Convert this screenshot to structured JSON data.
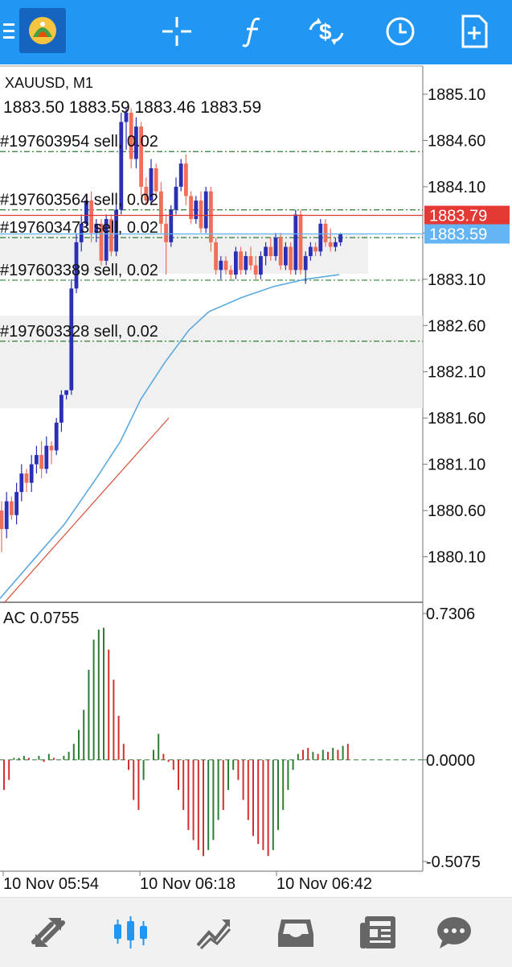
{
  "toolbar": {
    "icons": [
      "menu-icon",
      "metatrader-logo-icon",
      "crosshair-icon",
      "function-icon",
      "trade-icon",
      "clock-icon",
      "new-document-icon"
    ]
  },
  "chart_header": {
    "symbol": "XAUUSD, M1",
    "ohlc": "1883.50 1883.59 1883.46 1883.59"
  },
  "colors": {
    "accent": "#2196f3",
    "bull": "#2a2fb4",
    "bear": "#ef6f5a",
    "ask_line": "#e53935",
    "bid_line": "#64b5f6",
    "order_line": "#2e7d32",
    "ac_up": "#2e7d32",
    "ac_down": "#d32f2f"
  },
  "chart_data": {
    "type": "line",
    "price_axis": {
      "ticks": [
        "1885.10",
        "1884.60",
        "1884.10",
        "1883.60",
        "1883.10",
        "1882.60",
        "1882.10",
        "1881.60",
        "1881.10",
        "1880.60",
        "1880.10"
      ],
      "ylim": [
        1879.75,
        1885.3
      ]
    },
    "time_labels": [
      "10 Nov 05:54",
      "10 Nov 06:18",
      "10 Nov 06:42"
    ],
    "ask_price": "1883.79",
    "bid_price": "1883.59",
    "orders": [
      {
        "label": "#197603954 sell, 0.02",
        "price": 1884.48
      },
      {
        "label": "#197603564 sell, 0.02",
        "price": 1883.85
      },
      {
        "label": "#197603473 sell, 0.02",
        "price": 1883.55
      },
      {
        "label": "#197603389 sell, 0.02",
        "price": 1883.09
      },
      {
        "label": "#197603328 sell, 0.02",
        "price": 1882.43
      }
    ],
    "candles": [
      [
        1880.6,
        1880.7,
        1880.15,
        1880.4
      ],
      [
        1880.4,
        1880.8,
        1880.3,
        1880.7
      ],
      [
        1880.7,
        1880.75,
        1880.5,
        1880.55
      ],
      [
        1880.55,
        1880.9,
        1880.45,
        1880.8
      ],
      [
        1880.8,
        1881.1,
        1880.7,
        1881.0
      ],
      [
        1881.0,
        1881.05,
        1880.8,
        1880.9
      ],
      [
        1880.9,
        1881.2,
        1880.8,
        1881.1
      ],
      [
        1881.1,
        1881.3,
        1881.0,
        1881.2
      ],
      [
        1881.2,
        1881.35,
        1880.95,
        1881.05
      ],
      [
        1881.05,
        1881.4,
        1881.0,
        1881.3
      ],
      [
        1881.3,
        1881.35,
        1881.1,
        1881.25
      ],
      [
        1881.25,
        1881.6,
        1881.2,
        1881.55
      ],
      [
        1881.55,
        1881.9,
        1881.45,
        1881.85
      ],
      [
        1881.85,
        1881.9,
        1881.8,
        1881.9
      ],
      [
        1881.9,
        1883.1,
        1881.85,
        1883.0
      ],
      [
        1883.0,
        1883.6,
        1882.95,
        1883.5
      ],
      [
        1883.5,
        1883.8,
        1883.4,
        1883.7
      ],
      [
        1883.7,
        1884.0,
        1883.65,
        1883.95
      ],
      [
        1883.95,
        1884.05,
        1883.5,
        1883.6
      ],
      [
        1883.6,
        1883.75,
        1883.5,
        1883.7
      ],
      [
        1883.7,
        1883.75,
        1883.25,
        1883.3
      ],
      [
        1883.3,
        1883.8,
        1883.25,
        1883.75
      ],
      [
        1883.75,
        1883.8,
        1883.35,
        1883.4
      ],
      [
        1883.4,
        1883.9,
        1883.35,
        1883.85
      ],
      [
        1883.85,
        1884.9,
        1883.8,
        1884.8
      ],
      [
        1884.8,
        1884.95,
        1884.5,
        1884.9
      ],
      [
        1884.9,
        1884.95,
        1884.3,
        1884.4
      ],
      [
        1884.4,
        1884.85,
        1884.3,
        1884.75
      ],
      [
        1884.75,
        1884.8,
        1884.0,
        1884.1
      ],
      [
        1884.1,
        1884.2,
        1883.9,
        1883.95
      ],
      [
        1883.95,
        1884.4,
        1883.9,
        1884.3
      ],
      [
        1884.3,
        1884.35,
        1884.0,
        1884.05
      ],
      [
        1884.05,
        1884.15,
        1883.6,
        1883.7
      ],
      [
        1883.7,
        1883.8,
        1883.15,
        1883.5
      ],
      [
        1883.5,
        1883.9,
        1883.45,
        1883.85
      ],
      [
        1883.85,
        1884.2,
        1883.8,
        1884.1
      ],
      [
        1884.1,
        1884.4,
        1884.05,
        1884.35
      ],
      [
        1884.35,
        1884.45,
        1883.9,
        1884.0
      ],
      [
        1884.0,
        1884.05,
        1883.7,
        1883.75
      ],
      [
        1883.75,
        1884.0,
        1883.7,
        1883.95
      ],
      [
        1883.95,
        1884.05,
        1883.6,
        1883.65
      ],
      [
        1883.65,
        1884.1,
        1883.6,
        1884.05
      ],
      [
        1884.05,
        1884.1,
        1883.4,
        1883.5
      ],
      [
        1883.5,
        1883.55,
        1883.15,
        1883.2
      ],
      [
        1883.2,
        1883.35,
        1883.1,
        1883.3
      ],
      [
        1883.3,
        1883.35,
        1883.15,
        1883.2
      ],
      [
        1883.2,
        1883.25,
        1883.1,
        1883.15
      ],
      [
        1883.15,
        1883.45,
        1883.1,
        1883.4
      ],
      [
        1883.4,
        1883.45,
        1883.15,
        1883.2
      ],
      [
        1883.2,
        1883.4,
        1883.15,
        1883.35
      ],
      [
        1883.35,
        1883.45,
        1883.2,
        1883.25
      ],
      [
        1883.25,
        1883.35,
        1883.1,
        1883.15
      ],
      [
        1883.15,
        1883.4,
        1883.1,
        1883.35
      ],
      [
        1883.35,
        1883.5,
        1883.25,
        1883.45
      ],
      [
        1883.45,
        1883.55,
        1883.3,
        1883.35
      ],
      [
        1883.35,
        1883.6,
        1883.3,
        1883.55
      ],
      [
        1883.55,
        1883.6,
        1883.2,
        1883.25
      ],
      [
        1883.25,
        1883.5,
        1883.2,
        1883.45
      ],
      [
        1883.45,
        1883.5,
        1883.15,
        1883.2
      ],
      [
        1883.2,
        1883.85,
        1883.15,
        1883.8
      ],
      [
        1883.8,
        1883.85,
        1883.15,
        1883.2
      ],
      [
        1883.2,
        1883.4,
        1883.05,
        1883.35
      ],
      [
        1883.35,
        1883.5,
        1883.3,
        1883.45
      ],
      [
        1883.45,
        1883.5,
        1883.35,
        1883.4
      ],
      [
        1883.4,
        1883.75,
        1883.35,
        1883.7
      ],
      [
        1883.7,
        1883.75,
        1883.45,
        1883.5
      ],
      [
        1883.5,
        1883.65,
        1883.4,
        1883.45
      ],
      [
        1883.45,
        1883.55,
        1883.4,
        1883.5
      ],
      [
        1883.5,
        1883.6,
        1883.46,
        1883.59
      ]
    ],
    "moving_average": [
      [
        0,
        1879.65
      ],
      [
        40,
        1880.05
      ],
      [
        80,
        1880.45
      ],
      [
        120,
        1880.95
      ],
      [
        150,
        1881.35
      ],
      [
        175,
        1881.8
      ],
      [
        205,
        1882.2
      ],
      [
        235,
        1882.55
      ],
      [
        260,
        1882.75
      ],
      [
        300,
        1882.9
      ],
      [
        340,
        1883.02
      ],
      [
        380,
        1883.1
      ],
      [
        422,
        1883.15
      ]
    ],
    "trend_line": [
      [
        5,
        1879.6
      ],
      [
        210,
        1881.6
      ]
    ],
    "ac_indicator": {
      "title": "AC 0.0755",
      "ticks": [
        "0.7306",
        "0.0000",
        "-0.5075"
      ],
      "ylim": [
        -0.5075,
        0.7306
      ],
      "values": [
        -0.15,
        -0.1,
        0.01,
        0.01,
        0.02,
        0.01,
        0.0,
        0.02,
        -0.01,
        0.03,
        0.01,
        0.0,
        0.02,
        0.04,
        0.08,
        0.15,
        0.25,
        0.45,
        0.6,
        0.65,
        0.66,
        0.55,
        0.4,
        0.22,
        0.08,
        -0.05,
        -0.2,
        -0.25,
        -0.1,
        0.0,
        0.05,
        0.13,
        0.03,
        -0.01,
        -0.05,
        -0.15,
        -0.25,
        -0.35,
        -0.4,
        -0.45,
        -0.48,
        -0.45,
        -0.4,
        -0.3,
        -0.25,
        -0.15,
        -0.05,
        -0.1,
        -0.2,
        -0.3,
        -0.38,
        -0.42,
        -0.45,
        -0.48,
        -0.45,
        -0.35,
        -0.25,
        -0.15,
        -0.05,
        0.03,
        0.05,
        0.06,
        0.04,
        0.03,
        0.05,
        0.04,
        0.06,
        0.05,
        0.07,
        0.08
      ],
      "colors": [
        "down",
        "down",
        "up",
        "up",
        "up",
        "down",
        "up",
        "up",
        "down",
        "up",
        "down",
        "up",
        "up",
        "up",
        "up",
        "up",
        "up",
        "up",
        "up",
        "up",
        "up",
        "down",
        "down",
        "down",
        "down",
        "down",
        "down",
        "down",
        "up",
        "up",
        "up",
        "up",
        "down",
        "down",
        "down",
        "down",
        "down",
        "down",
        "down",
        "down",
        "down",
        "up",
        "up",
        "up",
        "down",
        "up",
        "up",
        "down",
        "down",
        "down",
        "down",
        "down",
        "down",
        "down",
        "up",
        "up",
        "up",
        "up",
        "up",
        "up",
        "down",
        "down",
        "up",
        "down",
        "up",
        "down",
        "up",
        "down",
        "up",
        "down"
      ]
    }
  }
}
